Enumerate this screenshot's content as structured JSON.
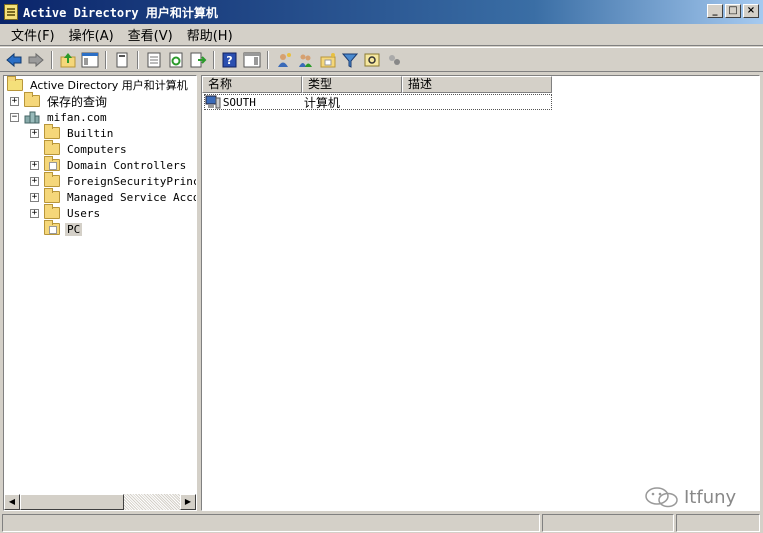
{
  "window": {
    "title": "Active Directory 用户和计算机",
    "buttons": {
      "minimize": "_",
      "maximize": "□",
      "close": "×"
    }
  },
  "menu": [
    {
      "label": "文件(F)"
    },
    {
      "label": "操作(A)"
    },
    {
      "label": "查看(V)"
    },
    {
      "label": "帮助(H)"
    }
  ],
  "toolbar_icons": [
    "back-arrow-icon",
    "forward-arrow-icon",
    "up-level-icon",
    "show-hide-tree-icon",
    "copy-icon",
    "properties-icon",
    "refresh-icon",
    "export-list-icon",
    "help-icon",
    "show-hide-action-pane-icon",
    "new-user-icon",
    "new-group-icon",
    "new-ou-icon",
    "filter-icon",
    "find-icon",
    "delegate-icon"
  ],
  "tree": {
    "root": "Active Directory 用户和计算机",
    "saved_queries": "保存的查询",
    "domain": "mifan.com",
    "children": [
      {
        "label": "Builtin",
        "expander": "+"
      },
      {
        "label": "Computers",
        "expander": ""
      },
      {
        "label": "Domain Controllers",
        "expander": "+"
      },
      {
        "label": "ForeignSecurityPrincip",
        "expander": "+"
      },
      {
        "label": "Managed Service Accoun",
        "expander": "+"
      },
      {
        "label": "Users",
        "expander": "+"
      },
      {
        "label": "PC",
        "expander": "",
        "selected": true
      }
    ]
  },
  "list": {
    "columns": [
      "名称",
      "类型",
      "描述"
    ],
    "rows": [
      {
        "name": "SOUTH",
        "type": "计算机",
        "description": ""
      }
    ]
  },
  "watermark": "Itfuny",
  "colors": {
    "title_gradient_start": "#0a246a",
    "title_gradient_end": "#a6caf0",
    "window_bg": "#d4d0c8",
    "folder": "#f5d77a"
  }
}
